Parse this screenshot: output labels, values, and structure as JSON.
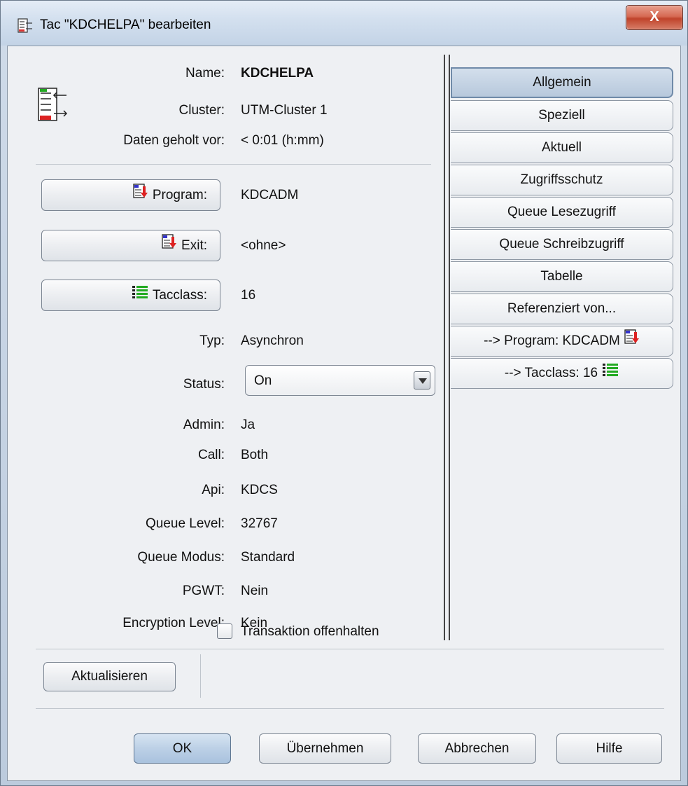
{
  "window": {
    "title": "Tac \"KDCHELPA\" bearbeiten",
    "close_label": "X"
  },
  "header": {
    "name_label": "Name:",
    "name_value": "KDCHELPA",
    "cluster_label": "Cluster:",
    "cluster_value": "UTM-Cluster 1",
    "fetched_label": "Daten geholt vor:",
    "fetched_value": "< 0:01 (h:mm)"
  },
  "links": {
    "program_label": "Program:",
    "program_value": "KDCADM",
    "exit_label": "Exit:",
    "exit_value": "<ohne>",
    "tacclass_label": "Tacclass:",
    "tacclass_value": "16"
  },
  "fields": [
    {
      "label": "Typ:",
      "value": "Asynchron"
    },
    {
      "label": "Admin:",
      "value": "Ja"
    },
    {
      "label": "Call:",
      "value": "Both"
    },
    {
      "label": "Api:",
      "value": "KDCS"
    },
    {
      "label": "Queue Level:",
      "value": "32767"
    },
    {
      "label": "Queue Modus:",
      "value": "Standard"
    },
    {
      "label": "PGWT:",
      "value": "Nein"
    },
    {
      "label": "Encryption Level:",
      "value": "Kein"
    }
  ],
  "status": {
    "label": "Status:",
    "value": "On"
  },
  "tabs": [
    {
      "label": "Allgemein",
      "active": true
    },
    {
      "label": "Speziell"
    },
    {
      "label": "Aktuell"
    },
    {
      "label": "Zugriffsschutz"
    },
    {
      "label": "Queue Lesezugriff"
    },
    {
      "label": "Queue Schreibzugriff"
    },
    {
      "label": "Tabelle"
    },
    {
      "label": "Referenziert von..."
    },
    {
      "label": "--> Program: KDCADM",
      "icon": "program-icon"
    },
    {
      "label": "--> Tacclass: 16",
      "icon": "tacclass-icon"
    }
  ],
  "refresh": {
    "button_label": "Aktualisieren",
    "checkbox_label": "Transaktion offenhalten",
    "checked": false
  },
  "footer": {
    "ok_label": "OK",
    "apply_label": "Übernehmen",
    "cancel_label": "Abbrechen",
    "help_label": "Hilfe"
  },
  "colors": {
    "accent": "#bcd0e6",
    "close": "#c0432b"
  }
}
